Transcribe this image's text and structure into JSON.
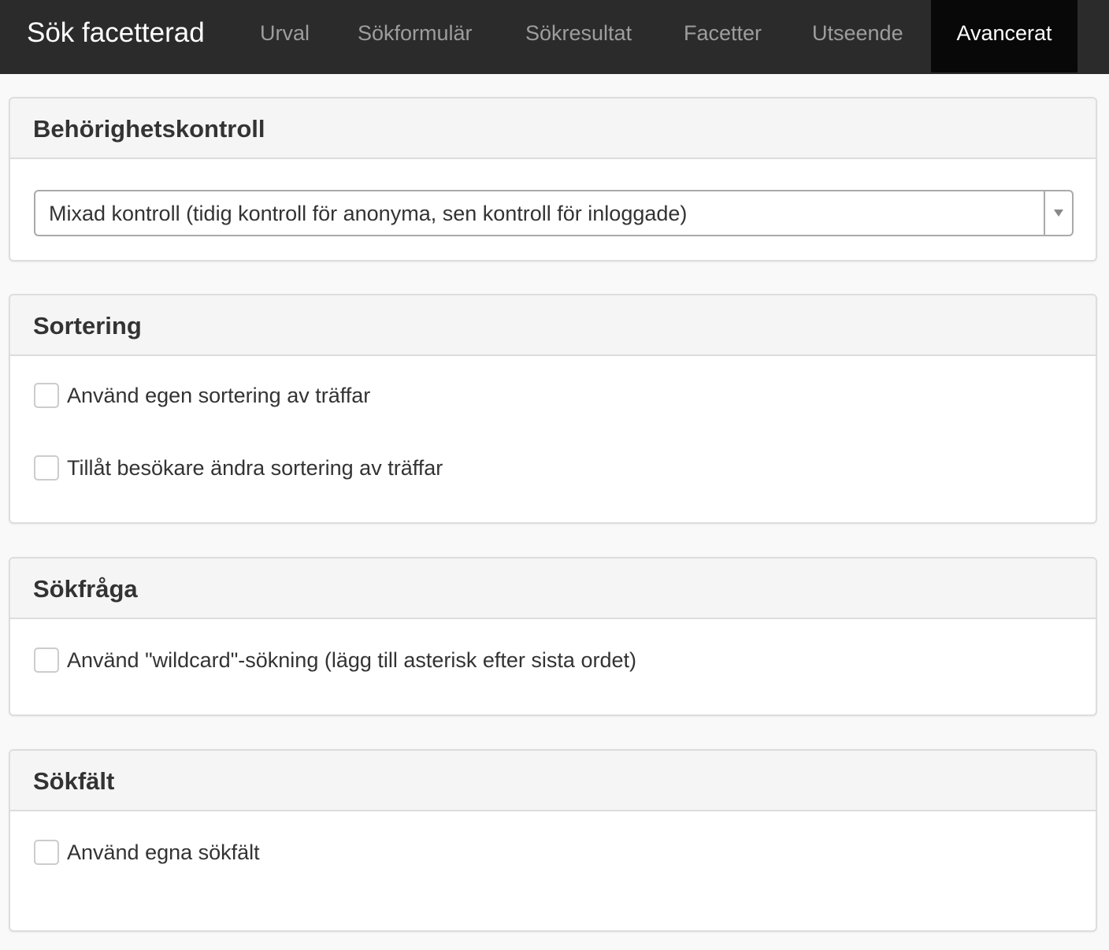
{
  "navbar": {
    "brand": "Sök facetterad",
    "tabs": [
      {
        "label": "Urval",
        "active": false
      },
      {
        "label": "Sökformulär",
        "active": false
      },
      {
        "label": "Sökresultat",
        "active": false
      },
      {
        "label": "Facetter",
        "active": false
      },
      {
        "label": "Utseende",
        "active": false
      },
      {
        "label": "Avancerat",
        "active": true
      }
    ]
  },
  "panels": {
    "access": {
      "title": "Behörighetskontroll",
      "select_value": "Mixad kontroll (tidig kontroll för anonyma, sen kontroll för inloggade)"
    },
    "sorting": {
      "title": "Sortering",
      "options": [
        {
          "label": "Använd egen sortering av träffar",
          "checked": false
        },
        {
          "label": "Tillåt besökare ändra sortering av träffar",
          "checked": false
        }
      ]
    },
    "query": {
      "title": "Sökfråga",
      "options": [
        {
          "label": "Använd \"wildcard\"-sökning (lägg till asterisk efter sista ordet)",
          "checked": false
        }
      ]
    },
    "fields": {
      "title": "Sökfält",
      "options": [
        {
          "label": "Använd egna sökfält",
          "checked": false
        }
      ]
    }
  },
  "colors": {
    "navbar_bg": "#2b2b2b",
    "active_tab_bg": "#080808",
    "inactive_tab_text": "#9d9d9d",
    "panel_heading_bg": "#f5f5f5"
  }
}
